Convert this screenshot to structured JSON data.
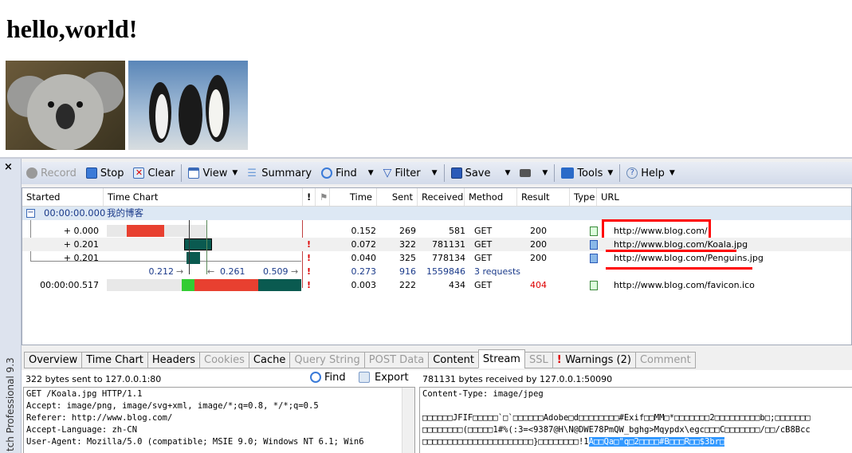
{
  "page": {
    "heading": "hello,world!"
  },
  "images": [
    {
      "name": "koala"
    },
    {
      "name": "penguins"
    }
  ],
  "fiddler": {
    "product": "tch Professional 9.3",
    "close": "×",
    "toolbar": {
      "record": "Record",
      "stop": "Stop",
      "clear": "Clear",
      "view": "View",
      "summary": "Summary",
      "find": "Find",
      "filter": "Filter",
      "save": "Save",
      "tools": "Tools",
      "help": "Help"
    },
    "columns": [
      "Started",
      "Time Chart",
      "!",
      "Time",
      "Sent",
      "Received",
      "Method",
      "Result",
      "Type",
      "URL"
    ],
    "group": {
      "started": "00:00:00.000",
      "title": "我的博客"
    },
    "rows": [
      {
        "started": "+ 0.000",
        "warn": "",
        "time": "0.152",
        "sent": "269",
        "received": "581",
        "method": "GET",
        "result": "200",
        "url": "http://www.blog.com/"
      },
      {
        "started": "+ 0.201",
        "warn": "!",
        "time": "0.072",
        "sent": "322",
        "received": "781131",
        "method": "GET",
        "result": "200",
        "url": "http://www.blog.com/Koala.jpg"
      },
      {
        "started": "+ 0.201",
        "warn": "!",
        "time": "0.040",
        "sent": "325",
        "received": "778134",
        "method": "GET",
        "result": "200",
        "url": "http://www.blog.com/Penguins.jpg"
      }
    ],
    "summary": {
      "t1": "0.212",
      "t2": "0.261",
      "t3": "0.509",
      "warn": "!",
      "time": "0.273",
      "sent": "916",
      "received": "1559846",
      "method": "3 requests"
    },
    "favicon": {
      "started": "00:00:00.517",
      "warn": "!",
      "time": "0.003",
      "sent": "222",
      "received": "434",
      "method": "GET",
      "result": "404",
      "url": "http://www.blog.com/favicon.ico"
    },
    "tabs": [
      "Overview",
      "Time Chart",
      "Headers",
      "Cookies",
      "Cache",
      "Query String",
      "POST Data",
      "Content",
      "Stream",
      "SSL",
      "Warnings (2)",
      "Comment"
    ],
    "active_tab": "Stream",
    "left": {
      "info": "322 bytes sent to 127.0.0.1:80",
      "find": "Find",
      "export": "Export",
      "lines": [
        "GET /Koala.jpg HTTP/1.1",
        "Accept: image/png, image/svg+xml, image/*;q=0.8, */*;q=0.5",
        "Referer: http://www.blog.com/",
        "Accept-Language: zh-CN",
        "User-Agent: Mozilla/5.0 (compatible; MSIE 9.0; Windows NT 6.1; Win6"
      ]
    },
    "right": {
      "info": "781131 bytes received by 127.0.0.1:50090",
      "lines": [
        "Content-Type: image/jpeg",
        "",
        "□□□□□□JFIF□□□□□`□`□□□□□□Adobe□d□□□□□□□□#Exif□□MM□*□□□□□□□2□□□□□□□□□b□;□□□□□□□",
        "□□□□□□□□(□□□□□1#%(:3=<9387@H\\N@DWE78PmQW_bghg>Mqypdx\\egc□□□C□□□□□□□/□□/cB8Bcc",
        "□□□□□□□□□□□□□□□□□□□□□□}□□□□□□□□!1"
      ],
      "selected": "A□□Qa□\"q□2□□□□#B□□□R□□$3br□"
    }
  },
  "colors": {
    "accent": "#1a3a8a",
    "error": "#d00000",
    "highlight": "#3399ff",
    "annotation": "#ff0000"
  }
}
